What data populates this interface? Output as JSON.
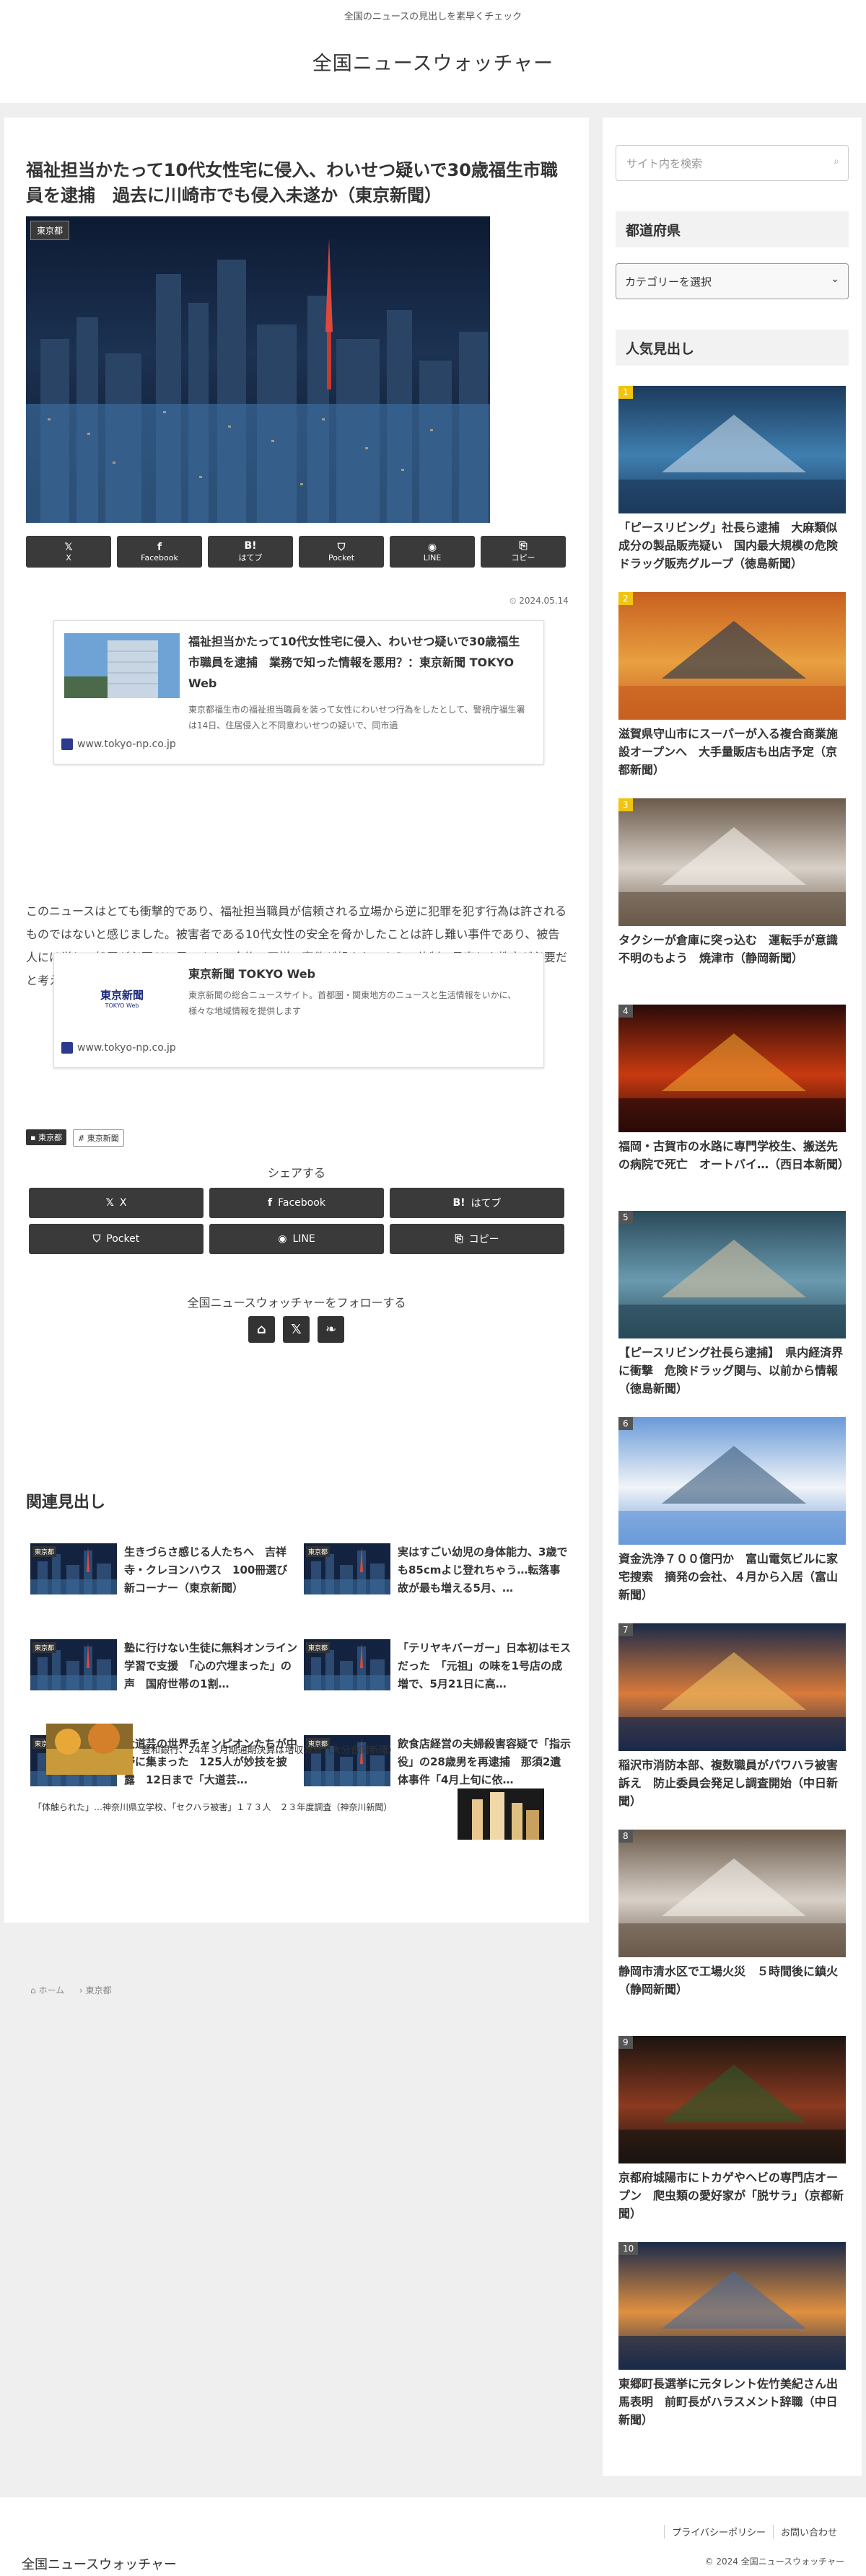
{
  "site": {
    "tagline": "全国のニュースの見出しを素早くチェック",
    "title": "全国ニュースウォッチャー"
  },
  "article": {
    "title": "福祉担当かたって10代女性宅に侵入、わいせつ疑いで30歳福生市職員を逮捕　過去に川崎市でも侵入未遂か（東京新聞）",
    "category_label": "東京都",
    "date": "2024.05.14",
    "body": "このニュースはとても衝撃的であり、福祉担当職員が信頼される立場から逆に犯罪を犯す行為は許されるものではないと感じました。被害者である10代女性の安全を脅かしたことは許し難い事件であり、被告人には厳しい処罰が必要だと思います。今後、同様の事件が起きないよう、体制の見直しや教育が必要だと考えました。"
  },
  "share_top": [
    {
      "icon": "𝕏",
      "label": "X"
    },
    {
      "icon": "f",
      "label": "Facebook"
    },
    {
      "icon": "B!",
      "label": "はてブ"
    },
    {
      "icon": "⛉",
      "label": "Pocket"
    },
    {
      "icon": "◉",
      "label": "LINE"
    },
    {
      "icon": "⎘",
      "label": "コピー"
    }
  ],
  "blogcard1": {
    "title": "福祉担当かたって10代女性宅に侵入、わいせつ疑いで30歳福生市職員を逮捕　業務で知った情報を悪用？：東京新聞 TOKYO Web",
    "desc": "東京都福生市の福祉担当職員を装って女性にわいせつ行為をしたとして、警視庁福生署は14日、住居侵入と不同意わいせつの疑いで、同市過",
    "url": "www.tokyo-np.co.jp"
  },
  "blogcard2": {
    "title": "東京新聞 TOKYO Web",
    "desc": "東京新聞の総合ニュースサイト。首都圏・関東地方のニュースと生活情報をいかに、様々な地域情報を提供します",
    "url": "www.tokyo-np.co.jp",
    "logo_text": "東京新聞",
    "logo_sub": "TOKYO Web"
  },
  "tags": {
    "category": "東京都",
    "tag": "東京新聞"
  },
  "share_section": {
    "heading": "シェアする",
    "buttons": [
      {
        "icon": "𝕏",
        "label": "X"
      },
      {
        "icon": "f",
        "label": "Facebook"
      },
      {
        "icon": "B!",
        "label": "はてブ"
      },
      {
        "icon": "⛉",
        "label": "Pocket"
      },
      {
        "icon": "◉",
        "label": "LINE"
      },
      {
        "icon": "⎘",
        "label": "コピー"
      }
    ]
  },
  "follow": {
    "heading": "全国ニュースウォッチャーをフォローする",
    "icons": [
      "⌂",
      "𝕏",
      "❧"
    ]
  },
  "related": {
    "heading": "関連見出し",
    "items": [
      {
        "label": "東京都",
        "title": "生きづらさ感じる人たちへ　吉祥寺・クレヨンハウス　100冊選び新コーナー（東京新聞）"
      },
      {
        "label": "東京都",
        "title": "実はすごい幼児の身体能力、3歳でも85cmよじ登れちゃう…転落事故が最も増える5月、…"
      },
      {
        "label": "東京都",
        "title": "塾に行けない生徒に無料オンライン学習で支援　「心の穴埋まった」の声　国府世帯の1割…"
      },
      {
        "label": "東京都",
        "title": "「テリヤキバーガー」日本初はモスだった　「元祖」の味を1号店の成増で、5月21日に高…"
      },
      {
        "label": "東京都",
        "title": "大道芸の世界チャンピオンたちが中野に集まった　125人が妙技を披露　12日まで「大道芸…"
      },
      {
        "label": "東京都",
        "title": "飲食店経営の夫婦殺害容疑で「指示役」の28歳男を再逮捕　那須2遺体事件「4月上旬に依…"
      }
    ]
  },
  "pager": {
    "next": "豊和銀行、24年３月期通期決算は増収減益（大分合同新聞）",
    "prev": "「体触られた」…神奈川県立学校、「セクハラ被害」１７３人　２３年度調査（神奈川新聞）"
  },
  "breadcrumb": {
    "home": "ホーム",
    "category": "東京都"
  },
  "sidebar": {
    "search_placeholder": "サイト内を検索",
    "search_icon": "search-icon",
    "pref_heading": "都道府県",
    "category_select": "カテゴリーを選択",
    "popular_heading": "人気見出し",
    "popular": [
      {
        "rank": "1",
        "title": "「ピースリビング」社長ら逮捕　大麻類似成分の製品販売疑い　国内最大規模の危険ドラッグ販売グループ（徳島新聞）"
      },
      {
        "rank": "2",
        "title": "滋賀県守山市にスーパーが入る複合商業施設オープンへ　大手量販店も出店予定（京都新聞）"
      },
      {
        "rank": "3",
        "title": "タクシーが倉庫に突っ込む　運転手が意識不明のもよう　焼津市（静岡新聞）"
      },
      {
        "rank": "4",
        "title": "福岡・古賀市の水路に専門学校生、搬送先の病院で死亡　オートバイ…（西日本新聞）"
      },
      {
        "rank": "5",
        "title": "【ピースリビング社長ら逮捕】　県内経済界に衝撃　危険ドラッグ関与、以前から情報（徳島新聞）"
      },
      {
        "rank": "6",
        "title": "資金洗浄７００億円か　富山電気ビルに家宅捜索　摘発の会社、４月から入居（富山新聞）"
      },
      {
        "rank": "7",
        "title": "稲沢市消防本部、複数職員がパワハラ被害訴え　防止委員会発足し調査開始（中日新聞）"
      },
      {
        "rank": "8",
        "title": "静岡市清水区で工場火災　５時間後に鎮火（静岡新聞）"
      },
      {
        "rank": "9",
        "title": "京都府城陽市にトカゲやヘビの専門店オープン　爬虫類の愛好家が「脱サラ」（京都新聞）"
      },
      {
        "rank": "10",
        "title": "東郷町長選挙に元タレント佐竹美紀さん出馬表明　前町長がハラスメント辞職（中日新聞）"
      }
    ]
  },
  "footer": {
    "title": "全国ニュースウォッチャー",
    "links": [
      "プライバシーポリシー",
      "お問い合わせ"
    ],
    "copyright": "© 2024 全国ニュースウォッチャー"
  }
}
